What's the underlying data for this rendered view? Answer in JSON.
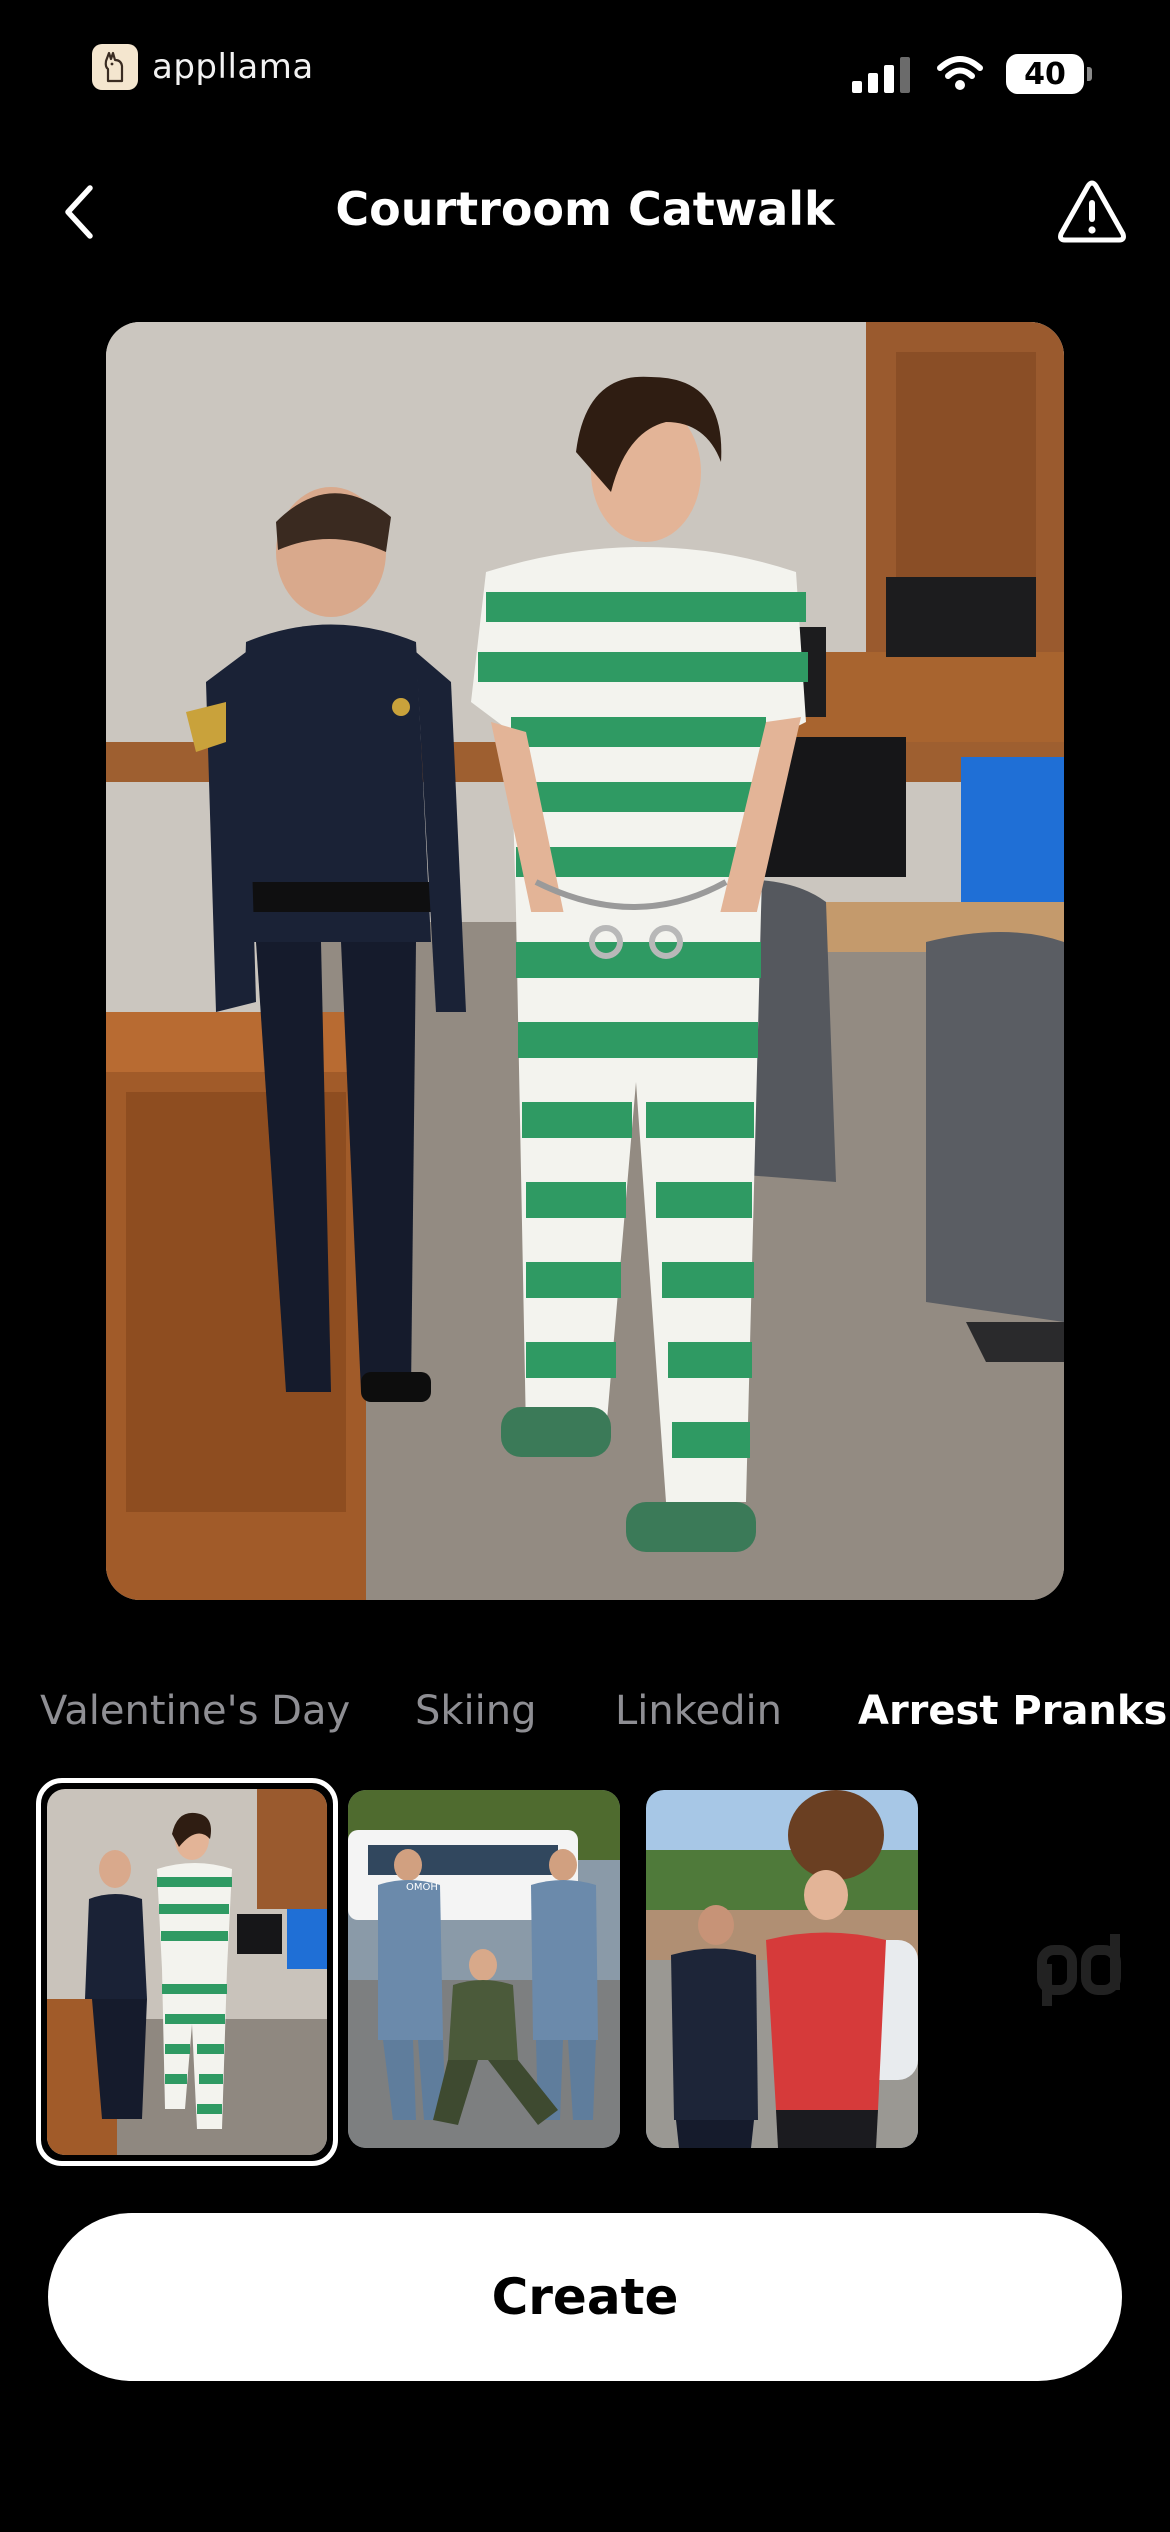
{
  "status_bar": {
    "app_name": "appllama",
    "battery_level": "40",
    "icons": [
      "llama-logo-icon",
      "cellular-signal-icon",
      "wifi-icon",
      "battery-icon"
    ]
  },
  "nav": {
    "title": "Courtroom Catwalk",
    "back_icon": "chevron-left-icon",
    "report_icon": "warning-triangle-icon"
  },
  "preview": {
    "scene": "courtroom-escort-photo"
  },
  "tabs": [
    {
      "label": "Valentine's Day",
      "active": false
    },
    {
      "label": "Skiing",
      "active": false
    },
    {
      "label": "Linkedin",
      "active": false
    },
    {
      "label": "Arrest Pranks",
      "active": true
    }
  ],
  "thumbnails": [
    {
      "id": "courtroom",
      "selected": true
    },
    {
      "id": "omon-arrest",
      "selected": false,
      "printed_text": "OMOH"
    },
    {
      "id": "street-arrest",
      "selected": false
    }
  ],
  "create_button": {
    "label": "Create"
  },
  "colors": {
    "background": "#000000",
    "inactive_tab": "#8e8e93",
    "active_tab": "#ffffff",
    "button": "#ffffff"
  }
}
